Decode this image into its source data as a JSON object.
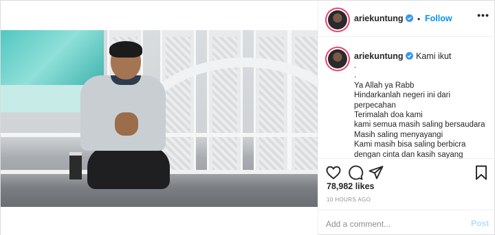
{
  "post": {
    "username": "ariekuntung",
    "follow_separator": "•",
    "follow_label": "Follow",
    "caption_first": "Kami ikut",
    "caption_lines": [
      ".",
      ".",
      "Ya Allah ya Rabb",
      "Hindarkanlah negeri ini dari",
      "perpecahan",
      "Terimalah doa kami",
      "kami semua masih saling bersaudara",
      "Masih saling menyayangi",
      "Kami masih bisa saling berbicra",
      "dengan cinta dan kasih sayang"
    ],
    "likes": "78,982 likes",
    "time_ago": "10 HOURS AGO",
    "comment_placeholder": "Add a comment...",
    "post_label": "Post"
  },
  "icons": {
    "more": "more-options-icon",
    "verified": "verified-badge-icon",
    "like": "heart-icon",
    "comment": "comment-icon",
    "share": "share-icon",
    "save": "bookmark-icon"
  },
  "colors": {
    "accent": "#0095f6",
    "post_disabled": "#b2dffc",
    "muted": "#8e8e8e",
    "text": "#262626",
    "verified": "#3897f0"
  }
}
